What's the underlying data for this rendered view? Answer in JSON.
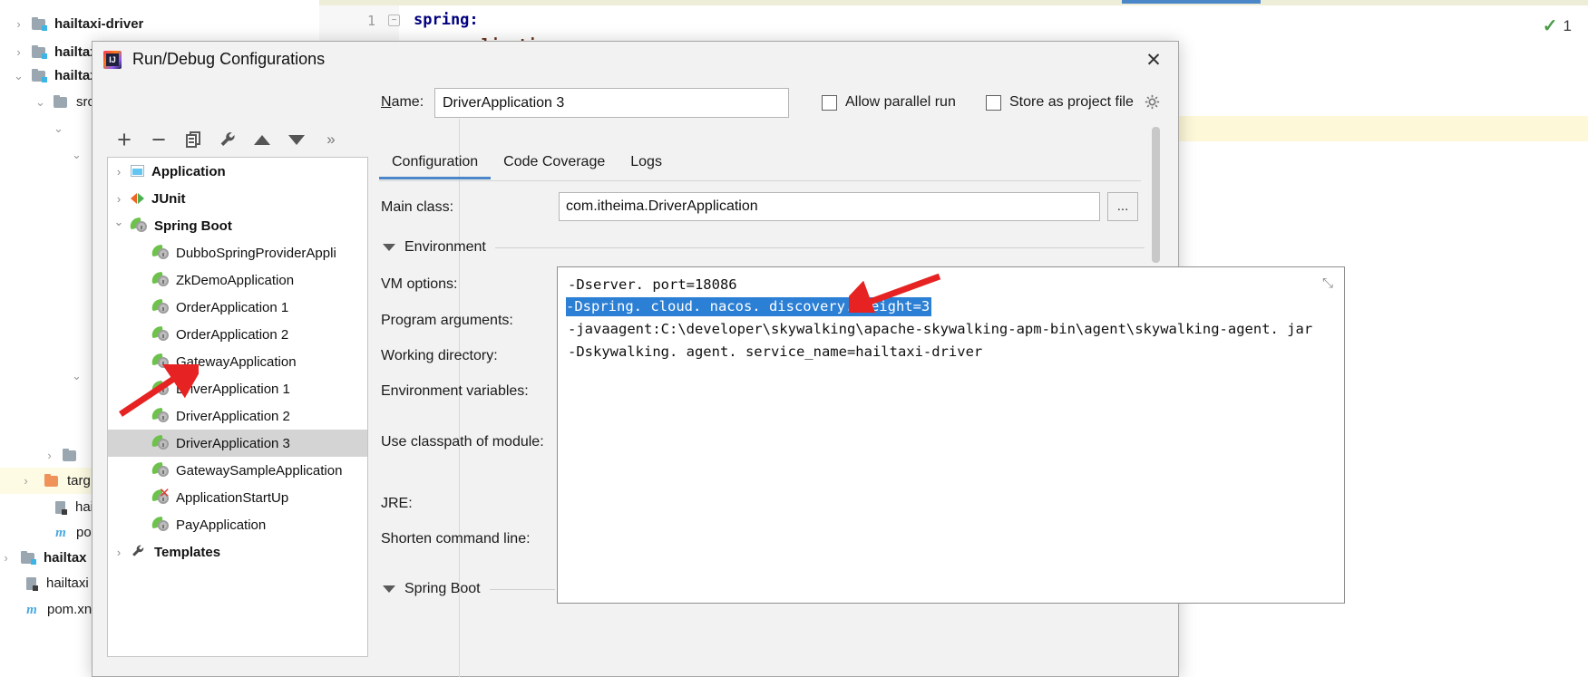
{
  "ide": {
    "project_tree": [
      {
        "label": "hailtaxi-driver",
        "icon": "folder-module-icon",
        "bold": true,
        "arrow": "right",
        "indent": 0
      },
      {
        "label": "hailtax",
        "icon": "folder-module-icon",
        "bold": true,
        "arrow": "right",
        "indent": 0
      },
      {
        "label": "hailtax",
        "icon": "folder-module-icon",
        "bold": true,
        "arrow": "down",
        "indent": 0
      },
      {
        "label": "src",
        "icon": "folder-plain-icon",
        "bold": false,
        "arrow": "down",
        "indent": 1
      },
      {
        "label": "",
        "icon": "folder-plain-icon",
        "bold": false,
        "arrow": "down",
        "indent": 2
      },
      {
        "label": "",
        "icon": "folder-plain-icon",
        "bold": false,
        "arrow": "down",
        "indent": 3
      },
      {
        "label": "",
        "icon": "folder-plain-icon",
        "bold": false,
        "arrow": "down",
        "indent": 2
      },
      {
        "label": "",
        "icon": "folder-plain-icon",
        "bold": false,
        "arrow": "right",
        "indent": 2
      },
      {
        "label": "targ",
        "icon": "folder-orange-icon",
        "bold": false,
        "arrow": "right",
        "indent": 1
      },
      {
        "label": "hai",
        "icon": "file-icon",
        "bold": false,
        "arrow": "none",
        "indent": 2
      },
      {
        "label": "pon",
        "icon": "maven-icon",
        "bold": false,
        "arrow": "none",
        "indent": 2
      },
      {
        "label": "hailtax",
        "icon": "folder-module-icon",
        "bold": true,
        "arrow": "right",
        "indent": 0
      },
      {
        "label": "hailtaxi",
        "icon": "file-icon",
        "bold": false,
        "arrow": "none",
        "indent": 1
      },
      {
        "label": "pom.xn",
        "icon": "maven-icon",
        "bold": false,
        "arrow": "none",
        "indent": 1
      }
    ],
    "editor": {
      "line_number": "1",
      "code_line_1": "spring:",
      "code_line_2": "application:",
      "inspection_count": "1"
    }
  },
  "dialog": {
    "title": "Run/Debug Configurations",
    "close_label": "✕",
    "toolbar": {
      "add": "+",
      "remove": "−",
      "copy": "copy",
      "edit_templates": "wrench",
      "move_up": "▲",
      "move_down": "▼",
      "more": "»"
    },
    "config_tree": [
      {
        "label": "Application",
        "icon": "application-icon",
        "arrow": "right",
        "bold": true,
        "indent": 0,
        "selected": false
      },
      {
        "label": "JUnit",
        "icon": "junit-icon",
        "arrow": "right",
        "bold": true,
        "indent": 0,
        "selected": false
      },
      {
        "label": "Spring Boot",
        "icon": "spring-boot-icon",
        "arrow": "down",
        "bold": true,
        "indent": 0,
        "selected": false
      },
      {
        "label": "DubboSpringProviderAppli",
        "icon": "spring-boot-icon",
        "arrow": "none",
        "bold": false,
        "indent": 1,
        "selected": false
      },
      {
        "label": "ZkDemoApplication",
        "icon": "spring-boot-icon",
        "arrow": "none",
        "bold": false,
        "indent": 1,
        "selected": false
      },
      {
        "label": "OrderApplication 1",
        "icon": "spring-boot-icon",
        "arrow": "none",
        "bold": false,
        "indent": 1,
        "selected": false
      },
      {
        "label": "OrderApplication 2",
        "icon": "spring-boot-icon",
        "arrow": "none",
        "bold": false,
        "indent": 1,
        "selected": false
      },
      {
        "label": "GatewayApplication",
        "icon": "spring-boot-icon",
        "arrow": "none",
        "bold": false,
        "indent": 1,
        "selected": false
      },
      {
        "label": "DriverApplication 1",
        "icon": "spring-boot-icon",
        "arrow": "none",
        "bold": false,
        "indent": 1,
        "selected": false
      },
      {
        "label": "DriverApplication 2",
        "icon": "spring-boot-icon",
        "arrow": "none",
        "bold": false,
        "indent": 1,
        "selected": false
      },
      {
        "label": "DriverApplication 3",
        "icon": "spring-boot-icon",
        "arrow": "none",
        "bold": false,
        "indent": 1,
        "selected": true
      },
      {
        "label": "GatewaySampleApplication",
        "icon": "spring-boot-icon",
        "arrow": "none",
        "bold": false,
        "indent": 1,
        "selected": false
      },
      {
        "label": "ApplicationStartUp",
        "icon": "spring-boot-error-icon",
        "arrow": "none",
        "bold": false,
        "indent": 1,
        "selected": false
      },
      {
        "label": "PayApplication",
        "icon": "spring-boot-icon",
        "arrow": "none",
        "bold": false,
        "indent": 1,
        "selected": false
      },
      {
        "label": "Templates",
        "icon": "wrench-icon",
        "arrow": "right",
        "bold": true,
        "indent": 0,
        "selected": false
      }
    ],
    "name_label": "Name:",
    "name_value": "DriverApplication 3",
    "allow_parallel_run": "Allow parallel run",
    "store_as_project_file": "Store as project file",
    "tabs": [
      {
        "label": "Configuration",
        "active": true
      },
      {
        "label": "Code Coverage",
        "active": false
      },
      {
        "label": "Logs",
        "active": false
      }
    ],
    "fields": {
      "main_class_label": "Main class:",
      "main_class_value": "com.itheima.DriverApplication",
      "browse_button": "...",
      "environment_section": "Environment",
      "vm_options_label": "VM options:",
      "program_arguments_label": "Program arguments:",
      "working_directory_label": "Working directory:",
      "environment_variables_label": "Environment variables:",
      "use_classpath_label": "Use classpath of module:",
      "jre_label": "JRE:",
      "shorten_command_line_label": "Shorten command line:",
      "spring_boot_section": "Spring Boot"
    },
    "vm_options_editor": {
      "lines": [
        {
          "text": "-Dserver. port=18086",
          "selected": false
        },
        {
          "text": "-Dspring. cloud. nacos. discovery. weight=3",
          "selected": true
        },
        {
          "text": "-javaagent:C:\\developer\\skywalking\\apache-skywalking-apm-bin\\agent\\skywalking-agent. jar",
          "selected": false
        },
        {
          "text": "-Dskywalking. agent. service_name=hailtaxi-driver",
          "selected": false
        }
      ],
      "collapse_icon": "collapse-icon"
    }
  },
  "colors": {
    "accent": "#4a86c8",
    "selection": "#2b7fd4",
    "tree_selection": "#d4d4d4",
    "arrow_red": "#e62222",
    "spring_green": "#6cc24a"
  }
}
